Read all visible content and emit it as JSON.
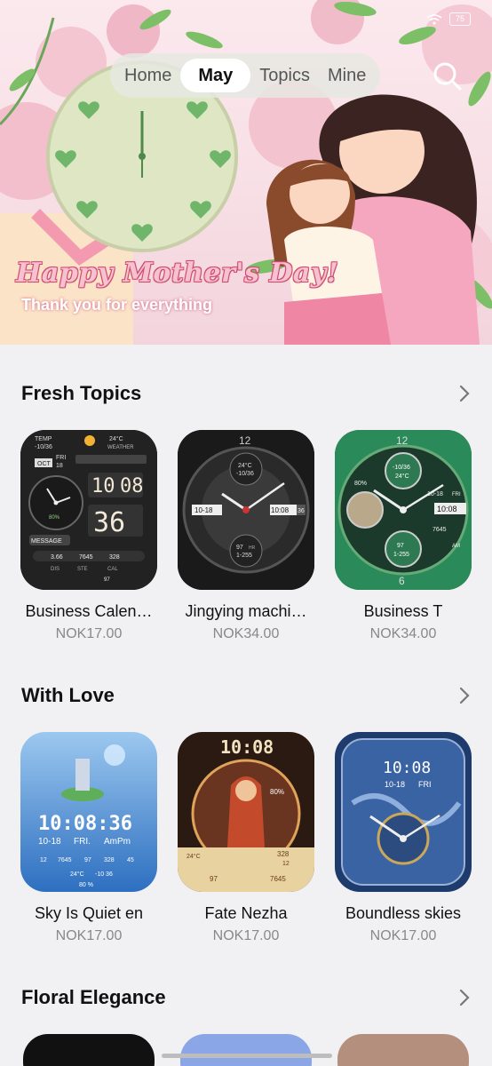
{
  "status": {
    "battery": "75"
  },
  "nav": {
    "tabs": [
      {
        "label": "Home"
      },
      {
        "label": "May"
      },
      {
        "label": "Topics"
      },
      {
        "label": "Mine"
      }
    ],
    "active_tab": "May"
  },
  "banner": {
    "title": "Happy Mother's Day!",
    "subtitle": "Thank you for everything"
  },
  "sections": [
    {
      "title": "Fresh Topics",
      "items": [
        {
          "name": "Business Calen…",
          "price": "NOK17.00",
          "face": {
            "top_left": "TEMP",
            "temp_range": "-10/36",
            "temp": "24°C",
            "weather": "WEATHER",
            "month": "OCT",
            "weekday": "FRI",
            "day": "18",
            "hour": "10",
            "minute": "08",
            "seconds": "36",
            "message": "MESSAGE",
            "stats": [
              "3.66",
              "7645",
              "328"
            ],
            "labels": [
              "DIS",
              "STE",
              "CAL"
            ],
            "heart": "97",
            "pct": "80%"
          }
        },
        {
          "name": "Jingying machi…",
          "price": "NOK34.00",
          "face": {
            "twelve": "12",
            "temp": "24°C",
            "temp_range": "-10/36",
            "date": "10-18",
            "time": "10:08",
            "seconds": "36",
            "hr": "97",
            "hr_label": "HR",
            "range": "1-255"
          }
        },
        {
          "name": "Business T",
          "price": "NOK34.00",
          "face": {
            "twelve": "12",
            "six": "6",
            "temp_range": "-10/36",
            "temp": "24°C",
            "pct": "80%",
            "date": "10-18",
            "weekday": "FRI",
            "time": "10:08",
            "steps": "7645",
            "hr": "97",
            "range": "1-255",
            "ampm": "AM"
          }
        }
      ]
    },
    {
      "title": "With Love",
      "items": [
        {
          "name": "Sky Is Quiet en",
          "price": "NOK17.00",
          "face": {
            "time": "10:08:36",
            "date": "10-18",
            "weekday": "FRI.",
            "ampm": "AmPm",
            "stats": [
              "12",
              "7645",
              "97",
              "328",
              "45"
            ],
            "temp": "24°C",
            "temp_range": "-10 36",
            "pct": "80 %"
          }
        },
        {
          "name": "Fate Nezha",
          "price": "NOK17.00",
          "face": {
            "time": "10:08",
            "pct": "80%",
            "temp": "24°C",
            "v1": "328",
            "v2": "12",
            "v3": "97",
            "v4": "7645"
          }
        },
        {
          "name": "Boundless skies",
          "price": "NOK17.00",
          "face": {
            "time": "10:08",
            "date": "10-18",
            "weekday": "FRI"
          }
        }
      ]
    },
    {
      "title": "Floral Elegance",
      "items": []
    }
  ],
  "colors": {
    "background": "#f1f1f3",
    "banner_pink": "#f7dfe5",
    "clock_green": "#dfe6c4",
    "heart_green": "#6fb56a",
    "price_gray": "#888888"
  }
}
